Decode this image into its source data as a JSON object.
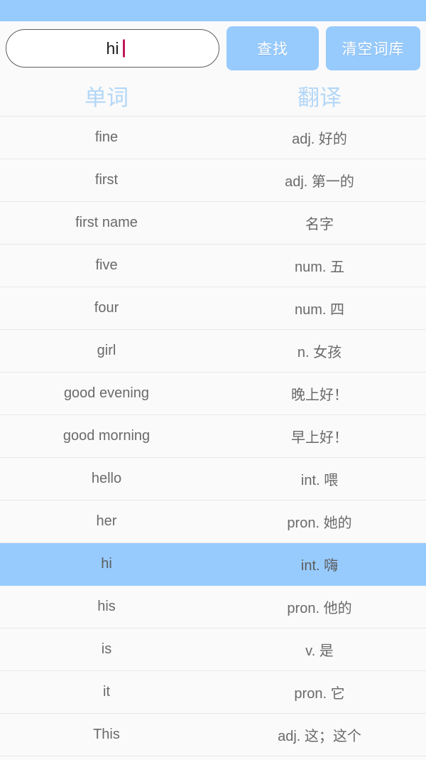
{
  "status_bar": {
    "color": "#97cbfd"
  },
  "toolbar": {
    "search": {
      "value": "hi",
      "placeholder": "",
      "caret_color": "#c2185b"
    },
    "find_label": "查找",
    "clear_label": "清空词库",
    "button_color": "#97cbfd"
  },
  "table": {
    "headers": {
      "word": "单词",
      "translation": "翻译"
    },
    "header_color": "#b3d7f7",
    "selected_row_color": "#97cbfd",
    "selected_index": 10,
    "rows": [
      {
        "word": "fine",
        "translation": "adj. 好的",
        "selected": false
      },
      {
        "word": "first",
        "translation": "adj. 第一的",
        "selected": false
      },
      {
        "word": "first name",
        "translation": "名字",
        "selected": false
      },
      {
        "word": "five",
        "translation": "num. 五",
        "selected": false
      },
      {
        "word": "four",
        "translation": "num. 四",
        "selected": false
      },
      {
        "word": "girl",
        "translation": "n. 女孩",
        "selected": false
      },
      {
        "word": "good evening",
        "translation": "晚上好！",
        "selected": false
      },
      {
        "word": "good morning",
        "translation": "早上好！",
        "selected": false
      },
      {
        "word": "hello",
        "translation": "int. 喂",
        "selected": false
      },
      {
        "word": "her",
        "translation": "pron. 她的",
        "selected": false
      },
      {
        "word": "hi",
        "translation": "int. 嗨",
        "selected": true
      },
      {
        "word": "his",
        "translation": "pron. 他的",
        "selected": false
      },
      {
        "word": "is",
        "translation": "v. 是",
        "selected": false
      },
      {
        "word": "it",
        "translation": "pron. 它",
        "selected": false
      },
      {
        "word": "This",
        "translation": "adj. 这；这个",
        "selected": false
      }
    ]
  }
}
